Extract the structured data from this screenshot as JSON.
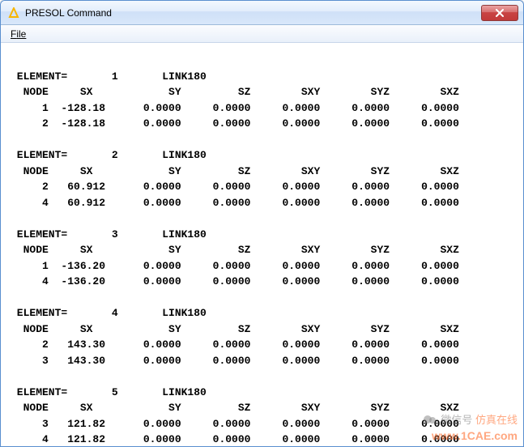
{
  "window": {
    "title": "PRESOL  Command"
  },
  "menubar": {
    "file": {
      "label": "File",
      "accelerator": "F"
    }
  },
  "columns": [
    "NODE",
    "SX",
    "SY",
    "SZ",
    "SXY",
    "SYZ",
    "SXZ"
  ],
  "elements": [
    {
      "id": "1",
      "type": "LINK180",
      "rows": [
        {
          "node": "1",
          "sx": "-128.18",
          "sy": "0.0000",
          "sz": "0.0000",
          "sxy": "0.0000",
          "syz": "0.0000",
          "sxz": "0.0000"
        },
        {
          "node": "2",
          "sx": "-128.18",
          "sy": "0.0000",
          "sz": "0.0000",
          "sxy": "0.0000",
          "syz": "0.0000",
          "sxz": "0.0000"
        }
      ]
    },
    {
      "id": "2",
      "type": "LINK180",
      "rows": [
        {
          "node": "2",
          "sx": "60.912",
          "sy": "0.0000",
          "sz": "0.0000",
          "sxy": "0.0000",
          "syz": "0.0000",
          "sxz": "0.0000"
        },
        {
          "node": "4",
          "sx": "60.912",
          "sy": "0.0000",
          "sz": "0.0000",
          "sxy": "0.0000",
          "syz": "0.0000",
          "sxz": "0.0000"
        }
      ]
    },
    {
      "id": "3",
      "type": "LINK180",
      "rows": [
        {
          "node": "1",
          "sx": "-136.20",
          "sy": "0.0000",
          "sz": "0.0000",
          "sxy": "0.0000",
          "syz": "0.0000",
          "sxz": "0.0000"
        },
        {
          "node": "4",
          "sx": "-136.20",
          "sy": "0.0000",
          "sz": "0.0000",
          "sxy": "0.0000",
          "syz": "0.0000",
          "sxz": "0.0000"
        }
      ]
    },
    {
      "id": "4",
      "type": "LINK180",
      "rows": [
        {
          "node": "2",
          "sx": "143.30",
          "sy": "0.0000",
          "sz": "0.0000",
          "sxy": "0.0000",
          "syz": "0.0000",
          "sxz": "0.0000"
        },
        {
          "node": "3",
          "sx": "143.30",
          "sy": "0.0000",
          "sz": "0.0000",
          "sxy": "0.0000",
          "syz": "0.0000",
          "sxz": "0.0000"
        }
      ]
    },
    {
      "id": "5",
      "type": "LINK180",
      "rows": [
        {
          "node": "3",
          "sx": "121.82",
          "sy": "0.0000",
          "sz": "0.0000",
          "sxy": "0.0000",
          "syz": "0.0000",
          "sxz": "0.0000"
        },
        {
          "node": "4",
          "sx": "121.82",
          "sy": "0.0000",
          "sz": "0.0000",
          "sxy": "0.0000",
          "syz": "0.0000",
          "sxz": "0.0000"
        }
      ]
    }
  ],
  "watermark": {
    "line1_prefix": "微信号",
    "line1_suffix": "仿真在线",
    "url": "www.1CAE.com"
  }
}
